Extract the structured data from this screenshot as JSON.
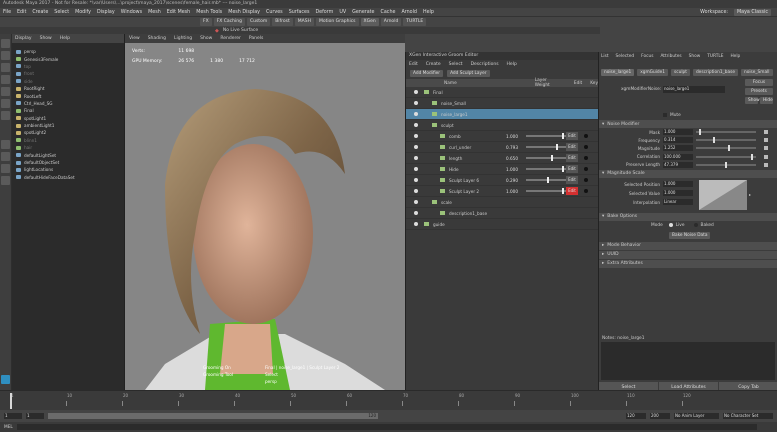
{
  "window": {
    "title": "Autodesk Maya 2017 - Not for Resale: *\\var\\Users\\...\\project\\maya_2017\\scenes\\female_hair.mb* --- noise_large1"
  },
  "menubar": {
    "items": [
      "File",
      "Edit",
      "Create",
      "Select",
      "Modify",
      "Display",
      "Windows",
      "Mesh",
      "Edit Mesh",
      "Mesh Tools",
      "Mesh Display",
      "Curves",
      "Surfaces",
      "Deform",
      "UV",
      "Generate",
      "Cache",
      "Arnold",
      "Help"
    ],
    "workspace_label": "Workspace:",
    "workspace_value": "Maya Classic"
  },
  "toolbar": {
    "live_surface": "No Live Surface"
  },
  "shelf": {
    "tabs": [
      "FX",
      "FX Caching",
      "Custom",
      "Bifrost",
      "MASH",
      "Motion Graphics",
      "XGen",
      "Arnold",
      "TURTLE"
    ],
    "selected": "XGen"
  },
  "outliner": {
    "menu": [
      "Display",
      "Show",
      "Help"
    ],
    "items": [
      "persp",
      "Genesis3Female",
      "top",
      "front",
      "side",
      "RootRight",
      "RootLeft",
      "Ctrl_Head_SG",
      "Final",
      "spotLight1",
      "ambientLight1",
      "spotLight2",
      "blinn1",
      "hair",
      "defaultLightSet",
      "defaultObjectSet",
      "lightLocations",
      "defaultHideFaceDataSet"
    ]
  },
  "viewport": {
    "menu": [
      "View",
      "Shading",
      "Lighting",
      "Show",
      "Renderer",
      "Panels"
    ],
    "hud": {
      "verts_label": "Verts:",
      "verts": "11 698",
      "gpu_label": "GPU Memory:",
      "gpu": "26 576",
      "col2": "1 380",
      "col3": "17 712"
    },
    "overlay": [
      "Grooming On",
      "Grooming Tool",
      "Final | noise_large1 | Sculpt Layer 2",
      "Select",
      "persp"
    ]
  },
  "groom_editor": {
    "title": "XGen Interactive Groom Editor",
    "menu": [
      "Edit",
      "Create",
      "Select",
      "Descriptions",
      "Help"
    ],
    "buttons": {
      "add_modifier": "Add Modifier",
      "add_layer": "Add Sculpt Layer"
    },
    "columns": {
      "name": "Name",
      "layer_weight": "Layer Weight",
      "edit": "Edit",
      "key": "Key"
    },
    "rows": [
      {
        "name": "Final",
        "indent": 0,
        "weight": "",
        "edit": "",
        "selected": false
      },
      {
        "name": "noise_Small",
        "indent": 1,
        "weight": "",
        "edit": "",
        "selected": false
      },
      {
        "name": "noise_large1",
        "indent": 1,
        "weight": "",
        "edit": "",
        "selected": true
      },
      {
        "name": "sculpt",
        "indent": 1,
        "weight": "",
        "edit": "",
        "selected": false
      },
      {
        "name": "comb",
        "indent": 2,
        "weight": "1.000",
        "slider": 0.95,
        "edit": "Edit",
        "red": false
      },
      {
        "name": "curl_under",
        "indent": 2,
        "weight": "0.793",
        "slider": 0.8,
        "edit": "Edit",
        "red": false
      },
      {
        "name": "length",
        "indent": 2,
        "weight": "0.650",
        "slider": 0.65,
        "edit": "Edit",
        "red": false
      },
      {
        "name": "Hide",
        "indent": 2,
        "weight": "1.000",
        "slider": 0.95,
        "edit": "Edit",
        "red": false
      },
      {
        "name": "Sculpt Layer 6",
        "indent": 2,
        "weight": "0.290",
        "slider": 0.55,
        "edit": "Edit",
        "red": false
      },
      {
        "name": "Sculpt Layer 2",
        "indent": 2,
        "weight": "1.000",
        "slider": 0.95,
        "edit": "Edit",
        "red": true
      },
      {
        "name": "scale",
        "indent": 1,
        "weight": "",
        "edit": "",
        "selected": false
      },
      {
        "name": "description1_base",
        "indent": 2,
        "weight": "",
        "edit": "",
        "selected": false
      },
      {
        "name": "guide",
        "indent": 0,
        "weight": "",
        "edit": "",
        "selected": false
      }
    ]
  },
  "attr_editor": {
    "menu": [
      "List",
      "Selected",
      "Focus",
      "Attributes",
      "Show",
      "TURTLE",
      "Help"
    ],
    "tabs": [
      "noise_large1",
      "xgmGuide1",
      "sculpt",
      "description1_base",
      "noise_Small"
    ],
    "node_label": "xgmModifierNoise:",
    "node_value": "noise_large1",
    "side_buttons": [
      "Focus",
      "Presets",
      "Show",
      "Hide"
    ],
    "mute_label": "Mute",
    "sections": {
      "noise": "Noise Modifier",
      "mag": "Magnitude Scale",
      "bake": "Bake Options",
      "mode": "Mode Behavior",
      "uuid": "UUID",
      "extra": "Extra Attributes"
    },
    "noise_attrs": [
      {
        "label": "Mask",
        "value": "1.000",
        "slider": 0.05
      },
      {
        "label": "Frequency",
        "value": "0.314",
        "slider": 0.3
      },
      {
        "label": "Magnitude",
        "value": "1.252",
        "slider": 0.55
      },
      {
        "label": "Correlation",
        "value": "100.000",
        "slider": 0.95
      },
      {
        "label": "Preserve Length",
        "value": "47.379",
        "slider": 0.5
      }
    ],
    "mag_attrs": [
      {
        "label": "Selected Position",
        "value": "1.000"
      },
      {
        "label": "Selected Value",
        "value": "1.000"
      },
      {
        "label": "Interpolation",
        "value": "Linear"
      }
    ],
    "bake": {
      "mode_label": "Mode",
      "opt1": "Live",
      "opt2": "Baked",
      "button": "Bake Noise Data"
    },
    "notes_label": "Notes: noise_large1",
    "bottom_buttons": [
      "Select",
      "Load Attributes",
      "Copy Tab"
    ]
  },
  "timeline": {
    "ticks": [
      "1",
      "10",
      "20",
      "30",
      "40",
      "50",
      "60",
      "70",
      "80",
      "90",
      "100",
      "110",
      "120"
    ],
    "current": "1"
  },
  "range": {
    "start": "1",
    "inner_start": "1",
    "inner_end": "120",
    "end": "120",
    "end2": "200",
    "anim_layer": "No Anim Layer",
    "char_set": "No Character Set"
  },
  "cmd": {
    "label": "MEL"
  },
  "colors": {
    "accent": "#5285a6",
    "red": "#d53030"
  }
}
